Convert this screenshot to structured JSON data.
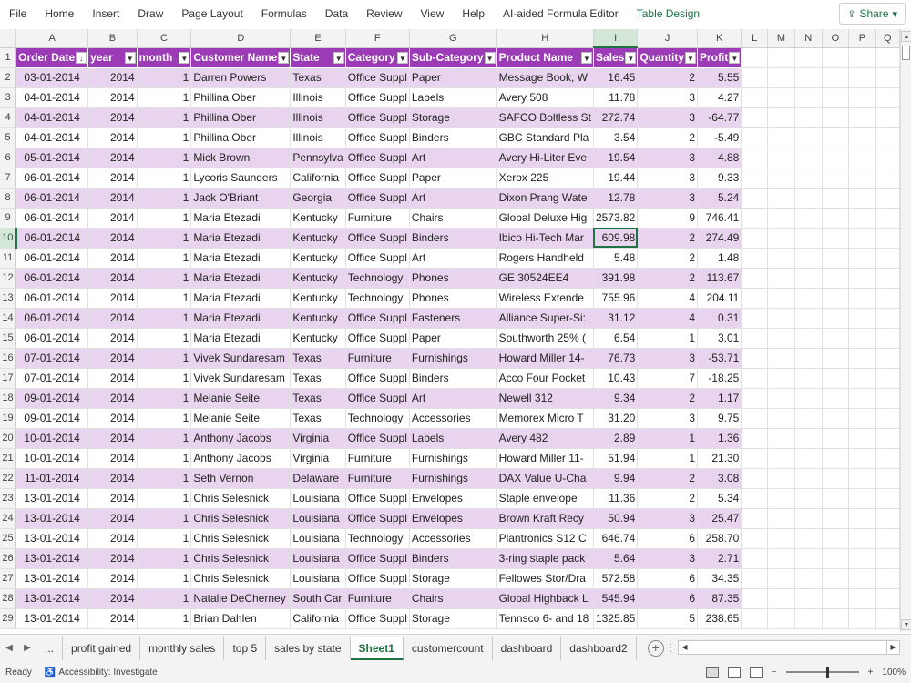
{
  "ribbon": {
    "tabs": [
      "File",
      "Home",
      "Insert",
      "Draw",
      "Page Layout",
      "Formulas",
      "Data",
      "Review",
      "View",
      "Help",
      "AI-aided Formula Editor",
      "Table Design"
    ],
    "share_label": "Share"
  },
  "grid": {
    "columns": [
      "A",
      "B",
      "C",
      "D",
      "E",
      "F",
      "G",
      "H",
      "I",
      "J",
      "K",
      "L",
      "M",
      "N",
      "O",
      "P",
      "Q"
    ],
    "selected_column": "I",
    "selected_row": 10,
    "headers": [
      "Order Date",
      "year",
      "month",
      "Customer Name",
      "State",
      "Category",
      "Sub-Category",
      "Product Name",
      "Sales",
      "Quantity",
      "Profit"
    ],
    "rows": [
      [
        "03-01-2014",
        "2014",
        "1",
        "Darren Powers",
        "Texas",
        "Office Suppl",
        "Paper",
        "Message Book, W",
        "16.45",
        "2",
        "5.55"
      ],
      [
        "04-01-2014",
        "2014",
        "1",
        "Phillina Ober",
        "Illinois",
        "Office Suppl",
        "Labels",
        "Avery 508",
        "11.78",
        "3",
        "4.27"
      ],
      [
        "04-01-2014",
        "2014",
        "1",
        "Phillina Ober",
        "Illinois",
        "Office Suppl",
        "Storage",
        "SAFCO Boltless St",
        "272.74",
        "3",
        "-64.77"
      ],
      [
        "04-01-2014",
        "2014",
        "1",
        "Phillina Ober",
        "Illinois",
        "Office Suppl",
        "Binders",
        "GBC Standard Pla",
        "3.54",
        "2",
        "-5.49"
      ],
      [
        "05-01-2014",
        "2014",
        "1",
        "Mick Brown",
        "Pennsylva",
        "Office Suppl",
        "Art",
        "Avery Hi-Liter Eve",
        "19.54",
        "3",
        "4.88"
      ],
      [
        "06-01-2014",
        "2014",
        "1",
        "Lycoris Saunders",
        "California",
        "Office Suppl",
        "Paper",
        "Xerox 225",
        "19.44",
        "3",
        "9.33"
      ],
      [
        "06-01-2014",
        "2014",
        "1",
        "Jack O'Briant",
        "Georgia",
        "Office Suppl",
        "Art",
        "Dixon Prang Wate",
        "12.78",
        "3",
        "5.24"
      ],
      [
        "06-01-2014",
        "2014",
        "1",
        "Maria Etezadi",
        "Kentucky",
        "Furniture",
        "Chairs",
        "Global Deluxe Hig",
        "2573.82",
        "9",
        "746.41"
      ],
      [
        "06-01-2014",
        "2014",
        "1",
        "Maria Etezadi",
        "Kentucky",
        "Office Suppl",
        "Binders",
        "Ibico Hi-Tech Mar",
        "609.98",
        "2",
        "274.49"
      ],
      [
        "06-01-2014",
        "2014",
        "1",
        "Maria Etezadi",
        "Kentucky",
        "Office Suppl",
        "Art",
        "Rogers Handheld",
        "5.48",
        "2",
        "1.48"
      ],
      [
        "06-01-2014",
        "2014",
        "1",
        "Maria Etezadi",
        "Kentucky",
        "Technology",
        "Phones",
        "GE 30524EE4",
        "391.98",
        "2",
        "113.67"
      ],
      [
        "06-01-2014",
        "2014",
        "1",
        "Maria Etezadi",
        "Kentucky",
        "Technology",
        "Phones",
        "Wireless Extende",
        "755.96",
        "4",
        "204.11"
      ],
      [
        "06-01-2014",
        "2014",
        "1",
        "Maria Etezadi",
        "Kentucky",
        "Office Suppl",
        "Fasteners",
        "Alliance Super-Si:",
        "31.12",
        "4",
        "0.31"
      ],
      [
        "06-01-2014",
        "2014",
        "1",
        "Maria Etezadi",
        "Kentucky",
        "Office Suppl",
        "Paper",
        "Southworth 25% (",
        "6.54",
        "1",
        "3.01"
      ],
      [
        "07-01-2014",
        "2014",
        "1",
        "Vivek Sundaresam",
        "Texas",
        "Furniture",
        "Furnishings",
        "Howard Miller 14-",
        "76.73",
        "3",
        "-53.71"
      ],
      [
        "07-01-2014",
        "2014",
        "1",
        "Vivek Sundaresam",
        "Texas",
        "Office Suppl",
        "Binders",
        "Acco Four Pocket",
        "10.43",
        "7",
        "-18.25"
      ],
      [
        "09-01-2014",
        "2014",
        "1",
        "Melanie Seite",
        "Texas",
        "Office Suppl",
        "Art",
        "Newell 312",
        "9.34",
        "2",
        "1.17"
      ],
      [
        "09-01-2014",
        "2014",
        "1",
        "Melanie Seite",
        "Texas",
        "Technology",
        "Accessories",
        "Memorex Micro T",
        "31.20",
        "3",
        "9.75"
      ],
      [
        "10-01-2014",
        "2014",
        "1",
        "Anthony Jacobs",
        "Virginia",
        "Office Suppl",
        "Labels",
        "Avery 482",
        "2.89",
        "1",
        "1.36"
      ],
      [
        "10-01-2014",
        "2014",
        "1",
        "Anthony Jacobs",
        "Virginia",
        "Furniture",
        "Furnishings",
        "Howard Miller 11-",
        "51.94",
        "1",
        "21.30"
      ],
      [
        "11-01-2014",
        "2014",
        "1",
        "Seth Vernon",
        "Delaware",
        "Furniture",
        "Furnishings",
        "DAX Value U-Cha",
        "9.94",
        "2",
        "3.08"
      ],
      [
        "13-01-2014",
        "2014",
        "1",
        "Chris Selesnick",
        "Louisiana",
        "Office Suppl",
        "Envelopes",
        "Staple envelope",
        "11.36",
        "2",
        "5.34"
      ],
      [
        "13-01-2014",
        "2014",
        "1",
        "Chris Selesnick",
        "Louisiana",
        "Office Suppl",
        "Envelopes",
        "Brown Kraft Recy",
        "50.94",
        "3",
        "25.47"
      ],
      [
        "13-01-2014",
        "2014",
        "1",
        "Chris Selesnick",
        "Louisiana",
        "Technology",
        "Accessories",
        "Plantronics S12 C",
        "646.74",
        "6",
        "258.70"
      ],
      [
        "13-01-2014",
        "2014",
        "1",
        "Chris Selesnick",
        "Louisiana",
        "Office Suppl",
        "Binders",
        "3-ring staple pack",
        "5.64",
        "3",
        "2.71"
      ],
      [
        "13-01-2014",
        "2014",
        "1",
        "Chris Selesnick",
        "Louisiana",
        "Office Suppl",
        "Storage",
        "Fellowes Stor/Dra",
        "572.58",
        "6",
        "34.35"
      ],
      [
        "13-01-2014",
        "2014",
        "1",
        "Natalie DeCherney",
        "South Car",
        "Furniture",
        "Chairs",
        "Global Highback L",
        "545.94",
        "6",
        "87.35"
      ],
      [
        "13-01-2014",
        "2014",
        "1",
        "Brian Dahlen",
        "California",
        "Office Suppl",
        "Storage",
        "Tennsco 6- and 18",
        "1325.85",
        "5",
        "238.65"
      ]
    ]
  },
  "sheet_tabs": {
    "ellipsis": "...",
    "tabs": [
      "profit gained",
      "monthly sales",
      "top 5",
      "sales by state",
      "Sheet1",
      "customercount",
      "dashboard",
      "dashboard2"
    ],
    "active": "Sheet1"
  },
  "status": {
    "ready": "Ready",
    "accessibility": "Accessibility: Investigate",
    "zoom": "100%"
  },
  "colors": {
    "header_purple": "#9c3bb6",
    "band_lavender": "#e9d4ef",
    "accent_green": "#217346"
  }
}
